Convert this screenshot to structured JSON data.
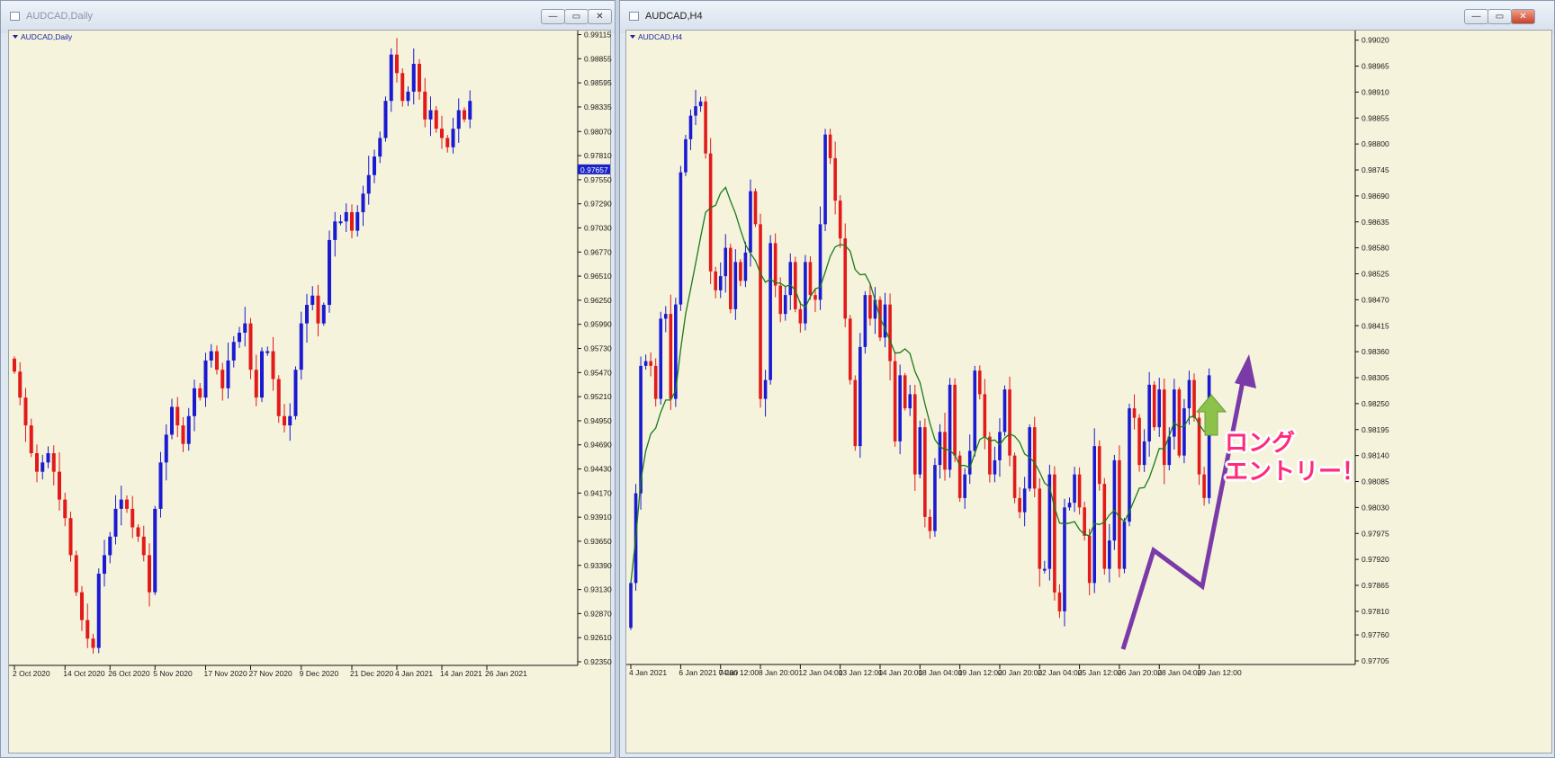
{
  "windows": {
    "left": {
      "title": "AUDCAD,Daily",
      "chart_label": "AUDCAD,Daily",
      "current_price": "0.97657"
    },
    "right": {
      "title": "AUDCAD,H4",
      "chart_label": "AUDCAD,H4"
    }
  },
  "window_buttons": {
    "minimize": "—",
    "restore": "▭",
    "close": "✕"
  },
  "annotation": {
    "line1": "ロング",
    "line2": "エントリー！"
  },
  "colors": {
    "bull": "#1a1ad2",
    "bear": "#e21a1a",
    "ma": "#1a7a1a",
    "arrow": "#7a3aa8",
    "up_arrow": "#8cc14a",
    "chart_bg": "#f5f3dc",
    "price_tag": "#1a22c8"
  },
  "icons": [
    "chart-window-icon",
    "minimize-icon",
    "restore-icon",
    "close-icon",
    "dropdown-triangle-icon",
    "up-arrow-icon",
    "zigzag-arrow-icon"
  ],
  "chart_data": [
    {
      "type": "candlestick",
      "symbol": "AUDCAD",
      "timeframe": "Daily",
      "ylim": [
        0.9235,
        0.9912
      ],
      "y_ticks": [
        "0.99115",
        "0.98855",
        "0.98595",
        "0.98335",
        "0.98070",
        "0.97810",
        "0.97550",
        "0.97290",
        "0.97030",
        "0.96770",
        "0.96510",
        "0.96250",
        "0.95990",
        "0.95730",
        "0.95470",
        "0.95210",
        "0.94950",
        "0.94690",
        "0.94430",
        "0.94170",
        "0.93910",
        "0.93650",
        "0.93390",
        "0.93130",
        "0.92870",
        "0.92610",
        "0.92350"
      ],
      "x_ticks": [
        {
          "label": "2 Oct 2020",
          "i": 0
        },
        {
          "label": "14 Oct 2020",
          "i": 9
        },
        {
          "label": "26 Oct 2020",
          "i": 17
        },
        {
          "label": "5 Nov 2020",
          "i": 25
        },
        {
          "label": "17 Nov 2020",
          "i": 34
        },
        {
          "label": "27 Nov 2020",
          "i": 42
        },
        {
          "label": "9 Dec 2020",
          "i": 51
        },
        {
          "label": "21 Dec 2020",
          "i": 60
        },
        {
          "label": "4 Jan 2021",
          "i": 68
        },
        {
          "label": "14 Jan 2021",
          "i": 76
        },
        {
          "label": "26 Jan 2021",
          "i": 84
        }
      ],
      "closes": [
        0.9548,
        0.952,
        0.949,
        0.946,
        0.944,
        0.945,
        0.946,
        0.944,
        0.941,
        0.939,
        0.935,
        0.931,
        0.928,
        0.926,
        0.925,
        0.933,
        0.935,
        0.937,
        0.94,
        0.941,
        0.94,
        0.938,
        0.937,
        0.935,
        0.931,
        0.94,
        0.945,
        0.948,
        0.951,
        0.949,
        0.947,
        0.95,
        0.953,
        0.952,
        0.956,
        0.957,
        0.955,
        0.953,
        0.956,
        0.958,
        0.959,
        0.96,
        0.955,
        0.952,
        0.957,
        0.957,
        0.954,
        0.95,
        0.949,
        0.95,
        0.955,
        0.96,
        0.962,
        0.963,
        0.96,
        0.962,
        0.969,
        0.971,
        0.971,
        0.972,
        0.97,
        0.972,
        0.974,
        0.976,
        0.978,
        0.98,
        0.984,
        0.989,
        0.987,
        0.984,
        0.985,
        0.988,
        0.985,
        0.982,
        0.983,
        0.981,
        0.98,
        0.979,
        0.981,
        0.983,
        0.982,
        0.984
      ]
    },
    {
      "type": "candlestick",
      "symbol": "AUDCAD",
      "timeframe": "H4",
      "series": [
        "candles",
        "moving-average"
      ],
      "ylim": [
        0.97705,
        0.99025
      ],
      "y_ticks": [
        "0.99020",
        "0.98965",
        "0.98910",
        "0.98855",
        "0.98800",
        "0.98745",
        "0.98690",
        "0.98635",
        "0.98580",
        "0.98525",
        "0.98470",
        "0.98415",
        "0.98360",
        "0.98305",
        "0.98250",
        "0.98195",
        "0.98140",
        "0.98085",
        "0.98030",
        "0.97975",
        "0.97920",
        "0.97865",
        "0.97810",
        "0.97760",
        "0.97705"
      ],
      "x_ticks": [
        {
          "label": "4 Jan 2021",
          "i": 0
        },
        {
          "label": "6 Jan 2021 04:00",
          "i": 10
        },
        {
          "label": "7 Jan 12:00",
          "i": 18
        },
        {
          "label": "8 Jan 20:00",
          "i": 26
        },
        {
          "label": "12 Jan 04:00",
          "i": 34
        },
        {
          "label": "13 Jan 12:00",
          "i": 42
        },
        {
          "label": "14 Jan 20:00",
          "i": 50
        },
        {
          "label": "18 Jan 04:00",
          "i": 58
        },
        {
          "label": "19 Jan 12:00",
          "i": 66
        },
        {
          "label": "20 Jan 20:00",
          "i": 74
        },
        {
          "label": "22 Jan 04:00",
          "i": 82
        },
        {
          "label": "25 Jan 12:00",
          "i": 90
        },
        {
          "label": "26 Jan 20:00",
          "i": 98
        },
        {
          "label": "28 Jan 04:00",
          "i": 106
        },
        {
          "label": "29 Jan 12:00",
          "i": 114
        }
      ],
      "closes": [
        0.9787,
        0.9806,
        0.9833,
        0.9834,
        0.9833,
        0.9826,
        0.9843,
        0.9844,
        0.9826,
        0.9846,
        0.9874,
        0.9881,
        0.9886,
        0.9888,
        0.9889,
        0.9878,
        0.9853,
        0.9849,
        0.9852,
        0.9858,
        0.9845,
        0.9855,
        0.9851,
        0.9857,
        0.987,
        0.9863,
        0.9826,
        0.983,
        0.9859,
        0.985,
        0.9844,
        0.9848,
        0.9855,
        0.9845,
        0.9842,
        0.9855,
        0.9848,
        0.9847,
        0.9863,
        0.9882,
        0.9877,
        0.9868,
        0.986,
        0.9843,
        0.983,
        0.9816,
        0.9837,
        0.9848,
        0.9843,
        0.9847,
        0.9839,
        0.9846,
        0.9834,
        0.9817,
        0.9831,
        0.9824,
        0.9827,
        0.981,
        0.982,
        0.9801,
        0.9798,
        0.9812,
        0.9819,
        0.9811,
        0.9829,
        0.9814,
        0.9805,
        0.981,
        0.9815,
        0.9832,
        0.9827,
        0.9818,
        0.981,
        0.9813,
        0.9819,
        0.9828,
        0.9814,
        0.9805,
        0.9802,
        0.9807,
        0.982,
        0.9807,
        0.979,
        0.979,
        0.981,
        0.9785,
        0.9781,
        0.9803,
        0.9804,
        0.981,
        0.9803,
        0.9797,
        0.9787,
        0.9816,
        0.9808,
        0.979,
        0.9796,
        0.9813,
        0.979,
        0.98,
        0.9824,
        0.9822,
        0.9812,
        0.9817,
        0.9829,
        0.982,
        0.9828,
        0.9812,
        0.9818,
        0.9828,
        0.9814,
        0.9824,
        0.983,
        0.9822,
        0.981,
        0.9805,
        0.9831
      ]
    }
  ]
}
